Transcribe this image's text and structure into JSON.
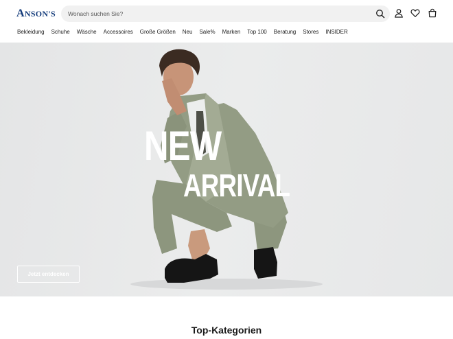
{
  "brand": {
    "logo_first": "A",
    "logo_rest": "NSON'S",
    "color": "#123a7a"
  },
  "search": {
    "placeholder": "Wonach suchen Sie?",
    "icon": "search-icon"
  },
  "header_icons": [
    "account-icon",
    "wishlist-heart-icon",
    "shopping-bag-icon"
  ],
  "nav": {
    "items": [
      {
        "label": "Bekleidung"
      },
      {
        "label": "Schuhe"
      },
      {
        "label": "Wäsche"
      },
      {
        "label": "Accessoires"
      },
      {
        "label": "Große Größen"
      },
      {
        "label": "Neu"
      },
      {
        "label": "Sale%"
      },
      {
        "label": "Marken"
      },
      {
        "label": "Top 100"
      },
      {
        "label": "Beratung"
      },
      {
        "label": "Stores"
      },
      {
        "label": "INSIDER"
      }
    ]
  },
  "hero": {
    "headline_line1": "NEW",
    "headline_line2": "ARRIVAL",
    "cta_label": "Jetzt entdecken",
    "image": "man-in-olive-suit-crouching"
  },
  "section": {
    "title": "Top-Kategorien"
  }
}
